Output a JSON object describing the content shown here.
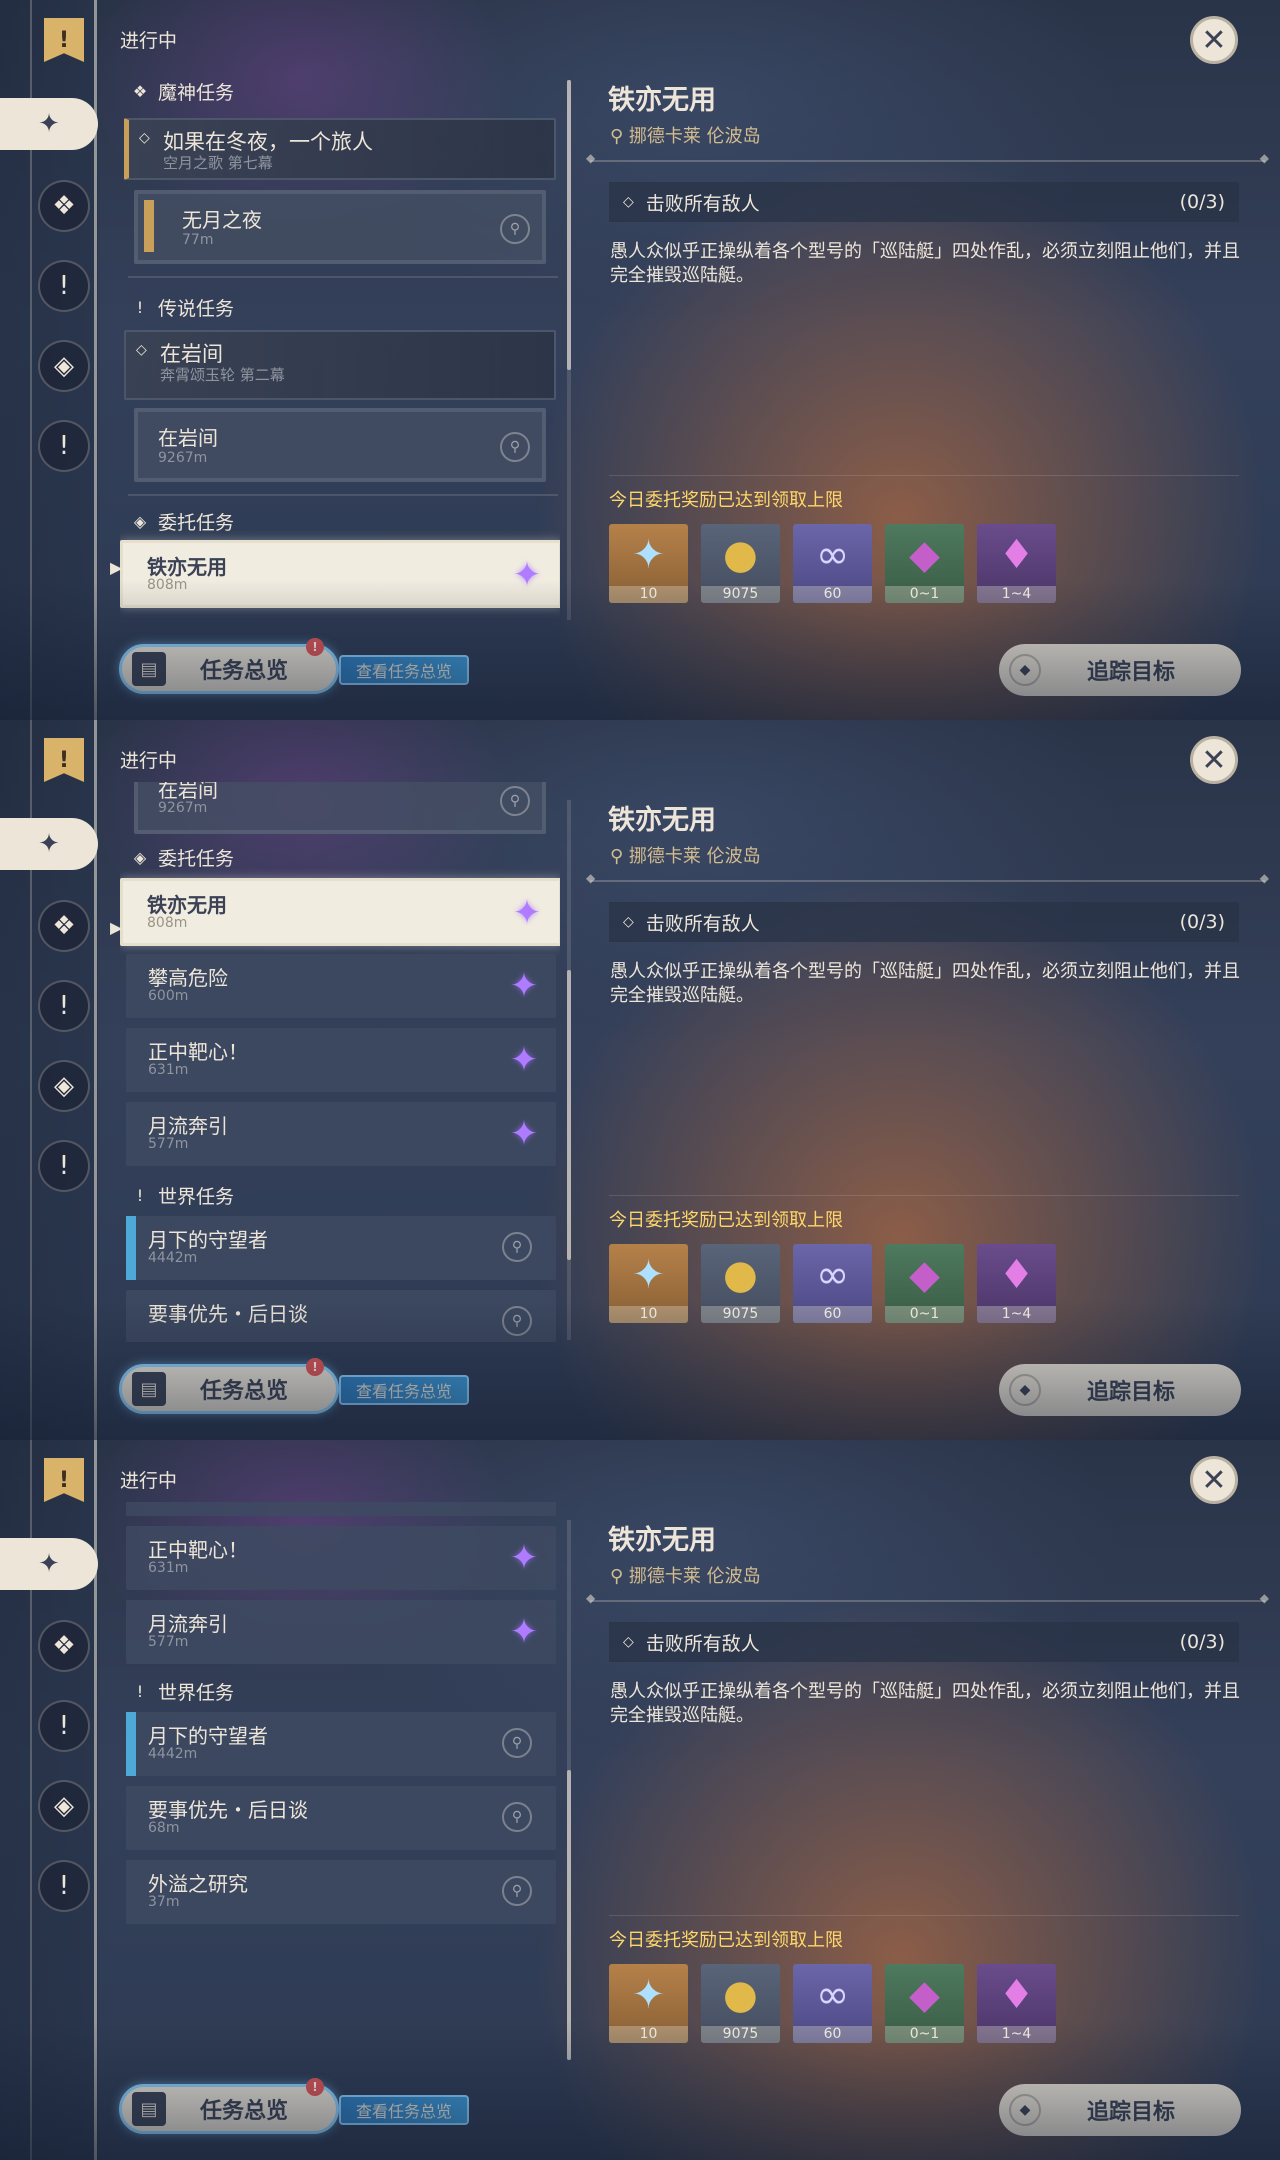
{
  "nav": {
    "status": "进行中",
    "icons": [
      "bookmark-icon",
      "all-quests-icon",
      "archon-quest-icon",
      "story-quest-icon",
      "commission-icon",
      "world-quest-icon"
    ]
  },
  "categories": {
    "archon": "魔神任务",
    "story": "传说任务",
    "commission": "委托任务",
    "world": "世界任务"
  },
  "quests": {
    "archon_chapter": {
      "title": "如果在冬夜，一个旅人",
      "subtitle": "空月之歌 第七幕"
    },
    "archon_sub": {
      "title": "无月之夜",
      "distance": "77m"
    },
    "story_chapter": {
      "title": "在岩间",
      "subtitle": "奔霄颂玉轮 第二幕"
    },
    "story_sub": {
      "title": "在岩间",
      "distance": "9267m"
    },
    "c1": {
      "title": "铁亦无用",
      "distance": "808m"
    },
    "c2": {
      "title": "攀高危险",
      "distance": "600m"
    },
    "c3": {
      "title": "正中靶心！",
      "distance": "631m"
    },
    "c4": {
      "title": "月流奔引",
      "distance": "577m"
    },
    "w1": {
      "title": "月下的守望者",
      "distance": "4442m"
    },
    "w2": {
      "title": "要事优先・后日谈",
      "distance": "68m"
    },
    "w3": {
      "title": "外溢之研究",
      "distance": "37m"
    },
    "partial_prev": {
      "distance": "600m"
    }
  },
  "detail": {
    "title": "铁亦无用",
    "location": "挪德卡莱 伦波岛",
    "objective": "击败所有敌人",
    "progress": "(0/3)",
    "description": "愚人众似乎正操纵着各个型号的「巡陆艇」四处作乱，必须立刻阻止他们，并且完全摧毁巡陆艇。",
    "reward_note": "今日委托奖励已达到领取上限",
    "rewards": [
      {
        "icon": "primogem-icon",
        "count": "10"
      },
      {
        "icon": "mora-icon",
        "count": "9075"
      },
      {
        "icon": "companionship-exp-icon",
        "count": "60"
      },
      {
        "icon": "green-crystal-icon",
        "count": "0~1"
      },
      {
        "icon": "purple-crystal-icon",
        "count": "1~4"
      }
    ]
  },
  "buttons": {
    "overview": "任务总览",
    "overview_badge": "!",
    "view_overview": "查看任务总览",
    "track": "追踪目标"
  }
}
